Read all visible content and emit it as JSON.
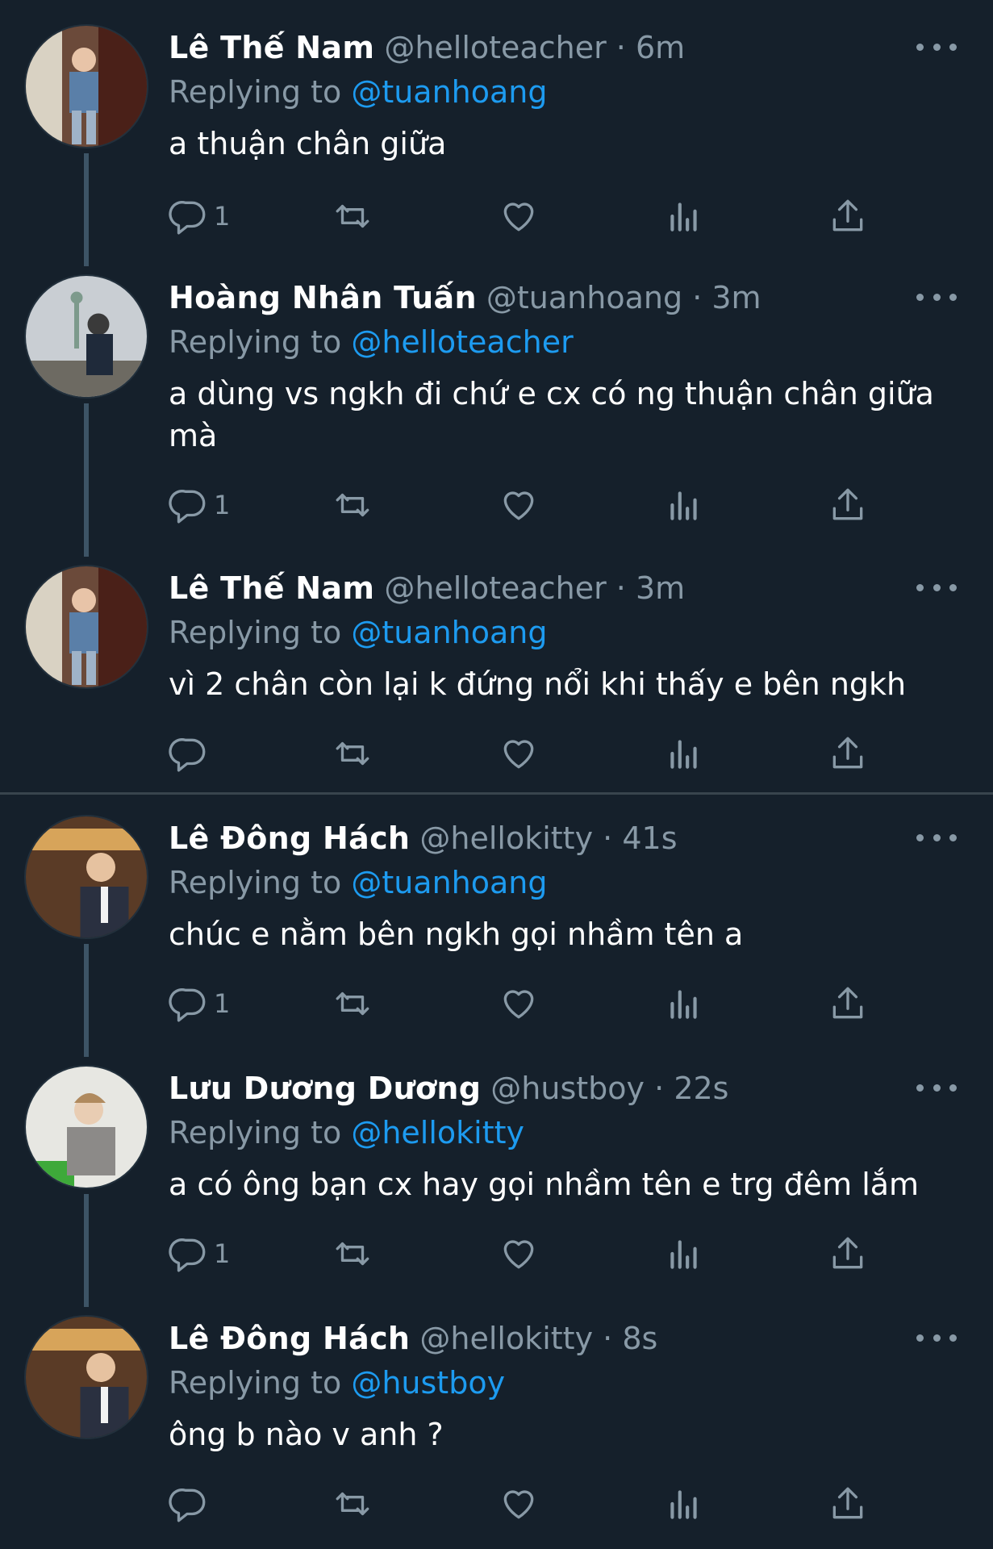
{
  "colors": {
    "background": "#15202b",
    "text": "#ffffff",
    "muted": "#8899a6",
    "link": "#1d9bf0",
    "thread_line": "#3d5466"
  },
  "tweets": [
    {
      "name": "Lê Thế Nam",
      "handle": "@helloteacher",
      "time": "6m",
      "reply_label": "Replying to",
      "reply_to": "@tuanhoang",
      "text": "a thuận chân giữa",
      "reply_count": "1",
      "avatar_icon": "avatar-icon"
    },
    {
      "name": "Hoàng Nhân Tuấn",
      "handle": "@tuanhoang",
      "time": "3m",
      "reply_label": "Replying to",
      "reply_to": "@helloteacher",
      "text": "a dùng vs ngkh đi chứ e cx có ng thuận chân giữa mà",
      "reply_count": "1",
      "avatar_icon": "avatar-icon"
    },
    {
      "name": "Lê Thế Nam",
      "handle": "@helloteacher",
      "time": "3m",
      "reply_label": "Replying to",
      "reply_to": "@tuanhoang",
      "text": "vì 2 chân còn lại k đứng nổi khi thấy e bên ngkh",
      "reply_count": "",
      "avatar_icon": "avatar-icon"
    },
    {
      "name": "Lê Đông Hách",
      "handle": "@hellokitty",
      "time": "41s",
      "reply_label": "Replying to",
      "reply_to": "@tuanhoang",
      "text": "chúc e nằm bên ngkh gọi nhầm tên a",
      "reply_count": "1",
      "avatar_icon": "avatar-icon"
    },
    {
      "name": "Lưu Dương Dương",
      "handle": "@hustboy",
      "time": "22s",
      "reply_label": "Replying to",
      "reply_to": "@hellokitty",
      "text": "a có ông bạn cx hay gọi nhầm tên e trg đêm lắm",
      "reply_count": "1",
      "avatar_icon": "avatar-icon"
    },
    {
      "name": "Lê Đông Hách",
      "handle": "@hellokitty",
      "time": "8s",
      "reply_label": "Replying to",
      "reply_to": "@hustboy",
      "text": "ông b nào v anh ?",
      "reply_count": "",
      "avatar_icon": "avatar-icon"
    }
  ],
  "separator_symbol": "·",
  "icons": [
    "reply-icon",
    "retweet-icon",
    "like-icon",
    "views-icon",
    "share-icon",
    "more-icon"
  ]
}
